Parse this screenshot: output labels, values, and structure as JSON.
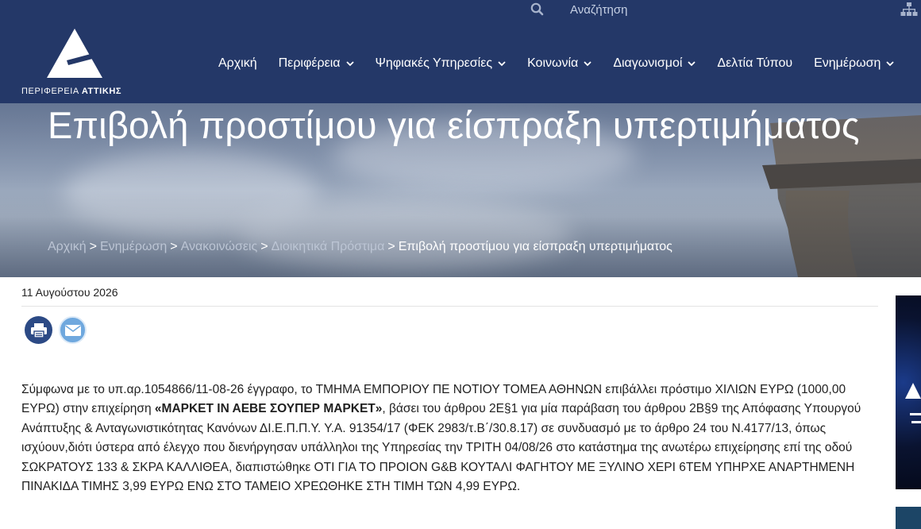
{
  "header": {
    "search_label": "Αναζήτηση",
    "logo_text_light": "ΠΕΡΙΦΕΡΕΙΑ ",
    "logo_text_bold": "ΑΤΤΙΚΗΣ"
  },
  "nav": {
    "items": [
      {
        "label": "Αρχική",
        "dropdown": false
      },
      {
        "label": "Περιφέρεια",
        "dropdown": true
      },
      {
        "label": "Ψηφιακές Υπηρεσίες",
        "dropdown": true
      },
      {
        "label": "Κοινωνία",
        "dropdown": true
      },
      {
        "label": "Διαγωνισμοί",
        "dropdown": true
      },
      {
        "label": "Δελτία Τύπου",
        "dropdown": false
      },
      {
        "label": "Ενημέρωση",
        "dropdown": true
      }
    ]
  },
  "hero": {
    "title": "Επιβολή προστίμου για είσπραξη υπερτιμήματος",
    "breadcrumb": {
      "links": [
        "Αρχική",
        "Ενημέρωση",
        "Ανακοινώσεις",
        "Διοικητικά Πρόστιμα"
      ],
      "separator": ">",
      "current": "Επιβολή προστίμου για είσπραξη υπερτιμήματος"
    }
  },
  "article": {
    "date": "11 Αυγούστου 2026",
    "body_part1": "Σύμφωνα με το υπ.αρ.1054866/11-08-26 έγγραφο, το ΤΜΗΜΑ ΕΜΠΟΡΙΟΥ ΠΕ ΝΟΤΙΟΥ ΤΟΜΕΑ ΑΘΗΝΩΝ επιβάλλει πρόστιμο ΧΙΛΙΩΝ ΕΥΡΩ (1000,00 ΕΥΡΩ) στην επιχείρηση ",
    "body_bold": "«ΜΑΡΚΕΤ ΙΝ ΑΕΒΕ ΣΟΥΠΕΡ ΜΑΡΚΕΤ»",
    "body_part2": ", βάσει του άρθρου 2Ε§1 για μία παράβαση του άρθρου 2Β§9 της Απόφασης Υπουργού Ανάπτυξης & Ανταγωνιστικότητας Κανόνων ΔΙ.Ε.Π.Π.Υ. Υ.Α. 91354/17 (ΦΕΚ 2983/τ.Β΄/30.8.17) σε συνδυασμό με το άρθρο 24 του Ν.4177/13, όπως ισχύουν,διότι ύστερα από έλεγχο που διενήργησαν υπάλληλοι της Υπηρεσίας την ΤΡΙΤΗ 04/08/26 στο κατάστημα της ανωτέρω επιχείρησης επί της οδού ΣΩΚΡΑΤΟΥΣ 133 & ΣΚΡΑ ΚΑΛΛΙΘΕΑ, διαπιστώθηκε ΟΤΙ ΓΙΑ ΤΟ ΠΡΟΙΟΝ G&B ΚΟΥΤΑΛΙ ΦΑΓΗΤΟΥ ΜΕ ΞΥΛΙΝΟ ΧΕΡΙ 6ΤΕΜ ΥΠΗΡΧΕ ΑΝΑΡΤΗΜΕΝΗ ΠΙΝΑΚΙΔΑ ΤΙΜΗΣ 3,99 ΕΥΡΩ ΕΝΩ ΣΤΟ ΤΑΜΕΙΟ ΧΡΕΩΘΗΚΕ ΣΤΗ ΤΙΜΗ ΤΩΝ 4,99 ΕΥΡΩ."
  },
  "icons": [
    "search-icon",
    "sitemap-icon",
    "chevron-down-icon",
    "print-icon",
    "mail-icon"
  ],
  "colors": {
    "header_bg": "#243868",
    "print_btn": "#2c4a85",
    "mail_btn": "#6fa8de"
  }
}
